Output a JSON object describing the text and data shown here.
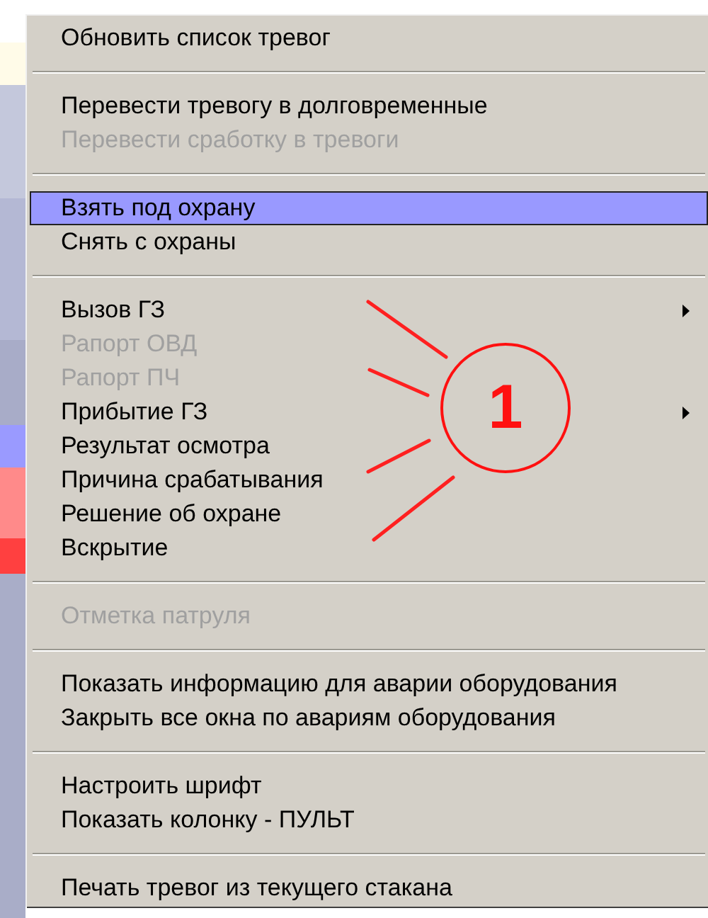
{
  "menu": {
    "items": [
      {
        "kind": "item",
        "label": "Обновить список тревог",
        "disabled": false,
        "selected": false,
        "submenu": false
      },
      {
        "kind": "separator"
      },
      {
        "kind": "item",
        "label": "Перевести тревогу в долговременные",
        "disabled": false,
        "selected": false,
        "submenu": false
      },
      {
        "kind": "item",
        "label": "Перевести сработку в тревоги",
        "disabled": true,
        "selected": false,
        "submenu": false
      },
      {
        "kind": "separator"
      },
      {
        "kind": "item",
        "label": "Взять под охрану",
        "disabled": false,
        "selected": true,
        "submenu": false
      },
      {
        "kind": "item",
        "label": "Снять с охраны",
        "disabled": false,
        "selected": false,
        "submenu": false
      },
      {
        "kind": "separator"
      },
      {
        "kind": "item",
        "label": "Вызов ГЗ",
        "disabled": false,
        "selected": false,
        "submenu": true
      },
      {
        "kind": "item",
        "label": "Рапорт ОВД",
        "disabled": true,
        "selected": false,
        "submenu": false
      },
      {
        "kind": "item",
        "label": "Рапорт ПЧ",
        "disabled": true,
        "selected": false,
        "submenu": false
      },
      {
        "kind": "item",
        "label": "Прибытие ГЗ",
        "disabled": false,
        "selected": false,
        "submenu": true
      },
      {
        "kind": "item",
        "label": "Результат осмотра",
        "disabled": false,
        "selected": false,
        "submenu": false
      },
      {
        "kind": "item",
        "label": "Причина срабатывания",
        "disabled": false,
        "selected": false,
        "submenu": false
      },
      {
        "kind": "item",
        "label": "Решение об охране",
        "disabled": false,
        "selected": false,
        "submenu": false
      },
      {
        "kind": "item",
        "label": "Вскрытие",
        "disabled": false,
        "selected": false,
        "submenu": false
      },
      {
        "kind": "separator"
      },
      {
        "kind": "item",
        "label": "Отметка патруля",
        "disabled": true,
        "selected": false,
        "submenu": false
      },
      {
        "kind": "separator"
      },
      {
        "kind": "item",
        "label": "Показать информацию для аварии оборудования",
        "disabled": false,
        "selected": false,
        "submenu": false
      },
      {
        "kind": "item",
        "label": "Закрыть все окна по авариям оборудования",
        "disabled": false,
        "selected": false,
        "submenu": false
      },
      {
        "kind": "separator"
      },
      {
        "kind": "item",
        "label": "Настроить шрифт",
        "disabled": false,
        "selected": false,
        "submenu": false
      },
      {
        "kind": "item",
        "label": "Показать колонку - ПУЛЬТ",
        "disabled": false,
        "selected": false,
        "submenu": false
      },
      {
        "kind": "separator"
      },
      {
        "kind": "item",
        "label": "Печать тревог из текущего стакана",
        "disabled": false,
        "selected": false,
        "submenu": false
      }
    ]
  },
  "annotation": {
    "label": "1"
  }
}
